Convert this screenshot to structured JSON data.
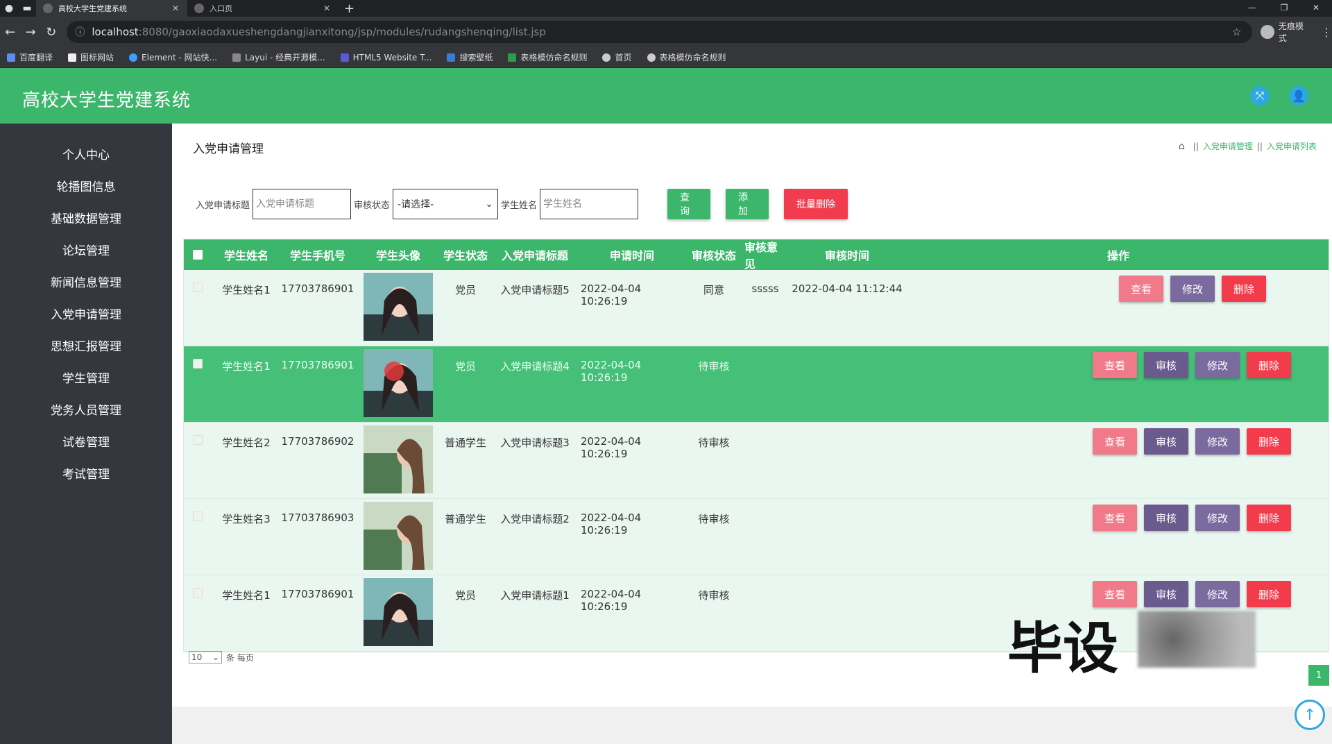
{
  "browser": {
    "tabs": [
      {
        "title": "高校大学生党建系统"
      },
      {
        "title": "入口页"
      }
    ],
    "url_host": "localhost",
    "url_rest": ":8080/gaoxiaodaxueshengdangjianxitong/jsp/modules/rudangshenqing/list.jsp",
    "profile_label": "无痕模式",
    "bookmarks": [
      "百度翻译",
      "图标网站",
      "Element - 网站快...",
      "Layui - 经典开源模...",
      "HTML5 Website T...",
      "搜索壁纸",
      "表格模仿命名规则",
      "首页",
      "表格模仿命名规则"
    ]
  },
  "app": {
    "title": "高校大学生党建系统"
  },
  "sidebar": {
    "items": [
      "个人中心",
      "轮播图信息",
      "基础数据管理",
      "论坛管理",
      "新闻信息管理",
      "入党申请管理",
      "思想汇报管理",
      "学生管理",
      "党务人员管理",
      "试卷管理",
      "考试管理"
    ]
  },
  "page": {
    "title": "入党申请管理",
    "breadcrumb": [
      "入党申请管理",
      "入党申请列表"
    ]
  },
  "search": {
    "title_label": "入党申请标题",
    "title_placeholder": "入党申请标题",
    "status_label": "审核状态",
    "status_value": "-请选择-",
    "name_label": "学生姓名",
    "name_placeholder": "学生姓名",
    "query": "查询",
    "add": "添加",
    "batch_delete": "批量删除"
  },
  "table": {
    "headers": [
      "学生姓名",
      "学生手机号",
      "学生头像",
      "学生状态",
      "入党申请标题",
      "申请时间",
      "审核状态",
      "审核意见",
      "审核时间",
      "操作"
    ],
    "rows": [
      {
        "name": "学生姓名1",
        "phone": "17703786901",
        "status": "党员",
        "title": "入党申请标题5",
        "apply_time": "2022-04-04 10:26:19",
        "audit_status": "同意",
        "opinion": "sssss",
        "audit_time": "2022-04-04 11:12:44"
      },
      {
        "name": "学生姓名1",
        "phone": "17703786901",
        "status": "党员",
        "title": "入党申请标题4",
        "apply_time": "2022-04-04 10:26:19",
        "audit_status": "待审核",
        "opinion": "",
        "audit_time": ""
      },
      {
        "name": "学生姓名2",
        "phone": "17703786902",
        "status": "普通学生",
        "title": "入党申请标题3",
        "apply_time": "2022-04-04 10:26:19",
        "audit_status": "待审核",
        "opinion": "",
        "audit_time": ""
      },
      {
        "name": "学生姓名3",
        "phone": "17703786903",
        "status": "普通学生",
        "title": "入党申请标题2",
        "apply_time": "2022-04-04 10:26:19",
        "audit_status": "待审核",
        "opinion": "",
        "audit_time": ""
      },
      {
        "name": "学生姓名1",
        "phone": "17703786901",
        "status": "党员",
        "title": "入党申请标题1",
        "apply_time": "2022-04-04 10:26:19",
        "audit_status": "待审核",
        "opinion": "",
        "audit_time": ""
      }
    ],
    "actions": {
      "view": "查看",
      "audit": "审核",
      "edit": "修改",
      "delete": "删除"
    }
  },
  "pager": {
    "page_size": "10",
    "per_page_label": "条 每页",
    "current_page": "1"
  },
  "watermark": "毕设",
  "colors": {
    "primary": "#3cb66b",
    "sidebar": "#34383e",
    "danger": "#f23b4b",
    "view": "#f07a8a",
    "audit": "#6b5a8e"
  }
}
